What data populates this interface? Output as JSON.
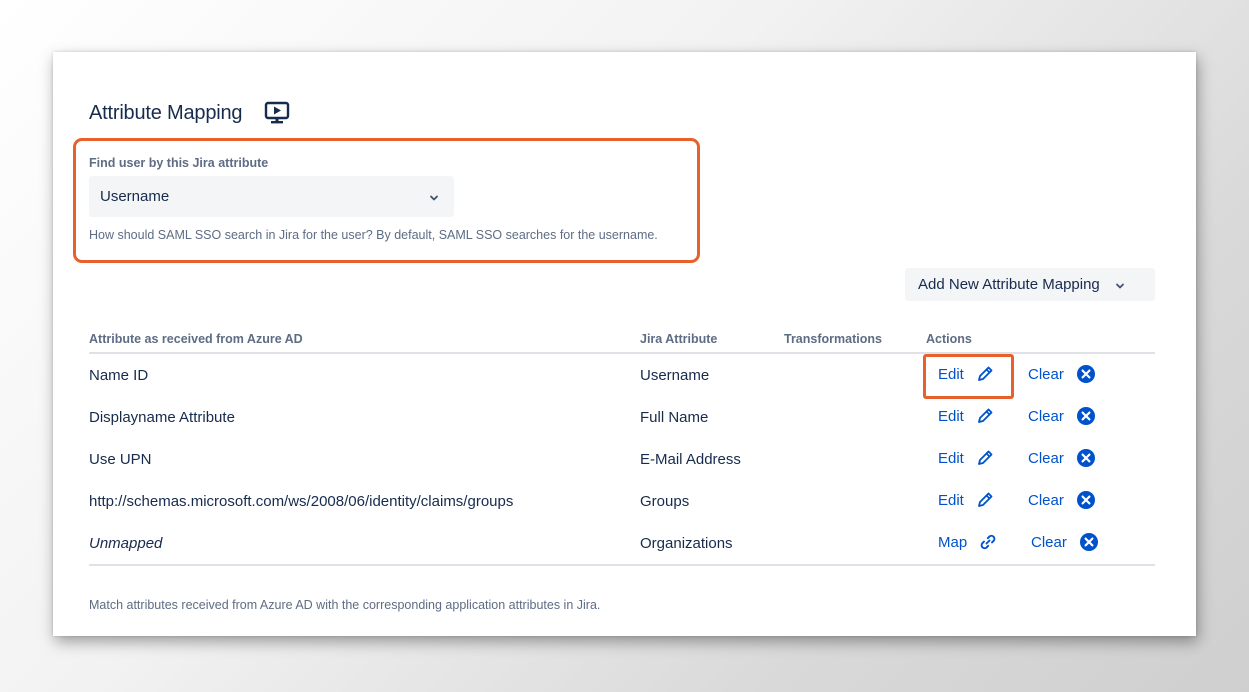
{
  "section": {
    "title": "Attribute Mapping",
    "video_icon": "video-play-icon"
  },
  "find_user": {
    "label": "Find user by this Jira attribute",
    "selected": "Username",
    "help": "How should SAML SSO search in Jira for the user? By default, SAML SSO searches for the username."
  },
  "add_button": {
    "label": "Add New Attribute Mapping"
  },
  "table": {
    "headers": [
      "Attribute as received from Azure AD",
      "Jira Attribute",
      "Transformations",
      "Actions"
    ],
    "rows": [
      {
        "source": "Name ID",
        "jira": "Username",
        "primary_action": "Edit",
        "primary_icon": "pencil-icon",
        "clear": "Clear"
      },
      {
        "source": "Displayname Attribute",
        "jira": "Full Name",
        "primary_action": "Edit",
        "primary_icon": "pencil-icon",
        "clear": "Clear"
      },
      {
        "source": "Use UPN",
        "jira": "E-Mail Address",
        "primary_action": "Edit",
        "primary_icon": "pencil-icon",
        "clear": "Clear"
      },
      {
        "source": "http://schemas.microsoft.com/ws/2008/06/identity/claims/groups",
        "jira": "Groups",
        "primary_action": "Edit",
        "primary_icon": "pencil-icon",
        "clear": "Clear"
      },
      {
        "source": "Unmapped",
        "jira": "Organizations",
        "primary_action": "Map",
        "primary_icon": "link-icon",
        "clear": "Clear"
      }
    ]
  },
  "footer": {
    "text": "Match attributes received from Azure AD with the corresponding application attributes in Jira."
  },
  "colors": {
    "highlight": "#e8602c",
    "link": "#0052cc",
    "text": "#172b4d",
    "subtle": "#5e6c84",
    "field_bg": "#f4f5f7"
  }
}
